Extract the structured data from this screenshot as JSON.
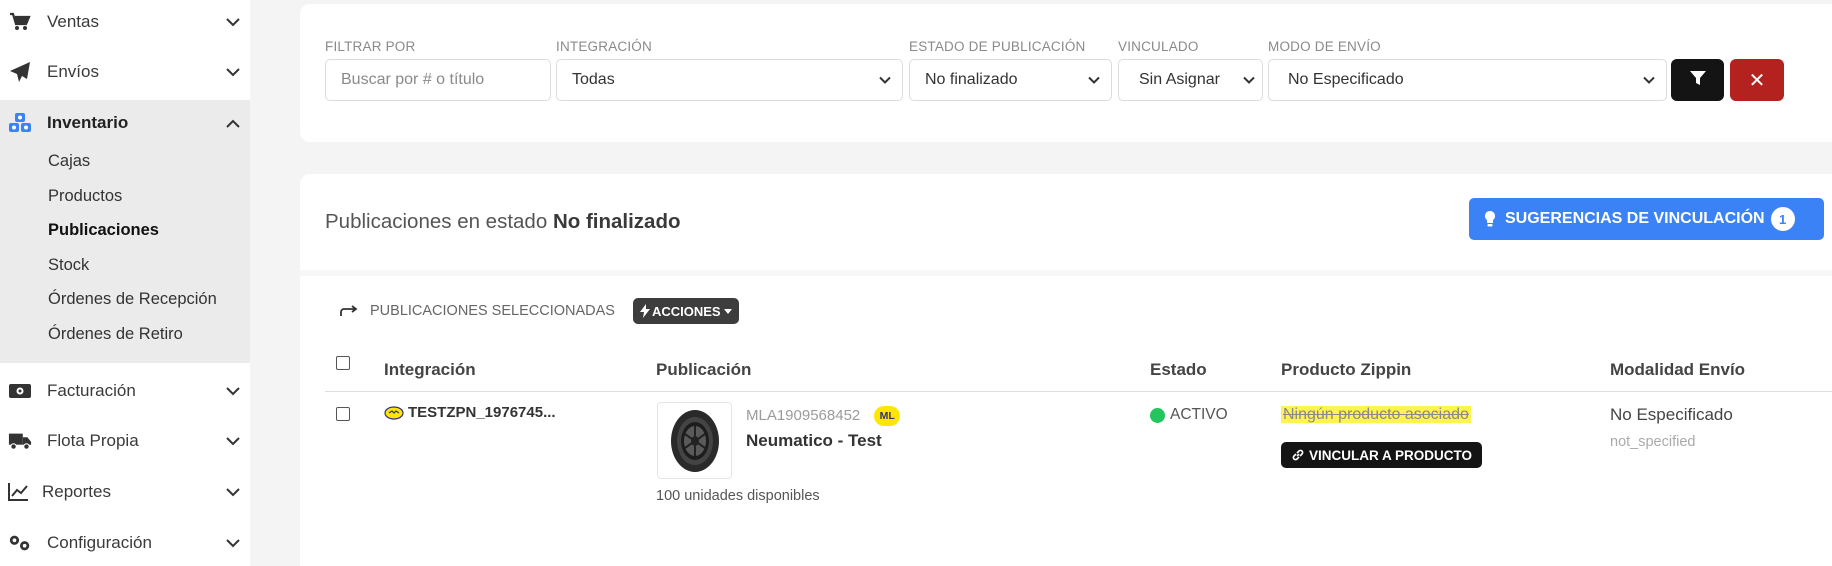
{
  "sidebar": {
    "items": [
      {
        "label": "Ventas",
        "icon": "cart-icon"
      },
      {
        "label": "Envíos",
        "icon": "paper-plane-icon"
      },
      {
        "label": "Inventario",
        "icon": "cubes-icon"
      },
      {
        "label": "Facturación",
        "icon": "money-bill-icon"
      },
      {
        "label": "Flota Propia",
        "icon": "truck-icon"
      },
      {
        "label": "Reportes",
        "icon": "chart-line-icon"
      },
      {
        "label": "Configuración",
        "icon": "cogs-icon"
      }
    ],
    "inventory_sub": [
      "Cajas",
      "Productos",
      "Publicaciones",
      "Stock",
      "Órdenes de Recepción",
      "Órdenes de Retiro"
    ],
    "active_sub": "Publicaciones"
  },
  "filters": {
    "filtrar_label": "FILTRAR POR",
    "search_placeholder": "Buscar por # o título",
    "integracion_label": "INTEGRACIÓN",
    "integracion_value": "Todas",
    "estado_label": "ESTADO DE PUBLICACIÓN",
    "estado_value": "No finalizado",
    "vinculado_label": "VINCULADO",
    "vinculado_value": "Sin Asignar",
    "envio_label": "MODO DE ENVÍO",
    "envio_value": "No Especificado",
    "clear_symbol": "✕"
  },
  "list": {
    "title_prefix": "Publicaciones en estado",
    "title_state": "No finalizado",
    "suggest_label": "SUGERENCIAS DE VINCULACIÓN",
    "suggest_count": "1",
    "selected_label": "PUBLICACIONES SELECCIONADAS",
    "actions_label": "ACCIONES",
    "columns": [
      "Integración",
      "Publicación",
      "Estado",
      "Producto Zippin",
      "Modalidad Envío"
    ],
    "rows": [
      {
        "integration": "TESTZPN_1976745...",
        "pub_id": "MLA1909568452",
        "marketplace_badge": "ML",
        "pub_title": "Neumatico - Test",
        "units": "100 unidades disponibles",
        "status": "ACTIVO",
        "product": "Ningún producto asociado",
        "link_label": "VINCULAR A PRODUCTO",
        "shipping": "No Especificado",
        "shipping_code": "not_specified"
      }
    ]
  },
  "colors": {
    "primary_blue": "#3b82f6",
    "danger_red": "#b3221f",
    "active_green": "#22c55e",
    "highlight_yellow": "#fff34d",
    "ml_yellow": "#ffe600"
  }
}
